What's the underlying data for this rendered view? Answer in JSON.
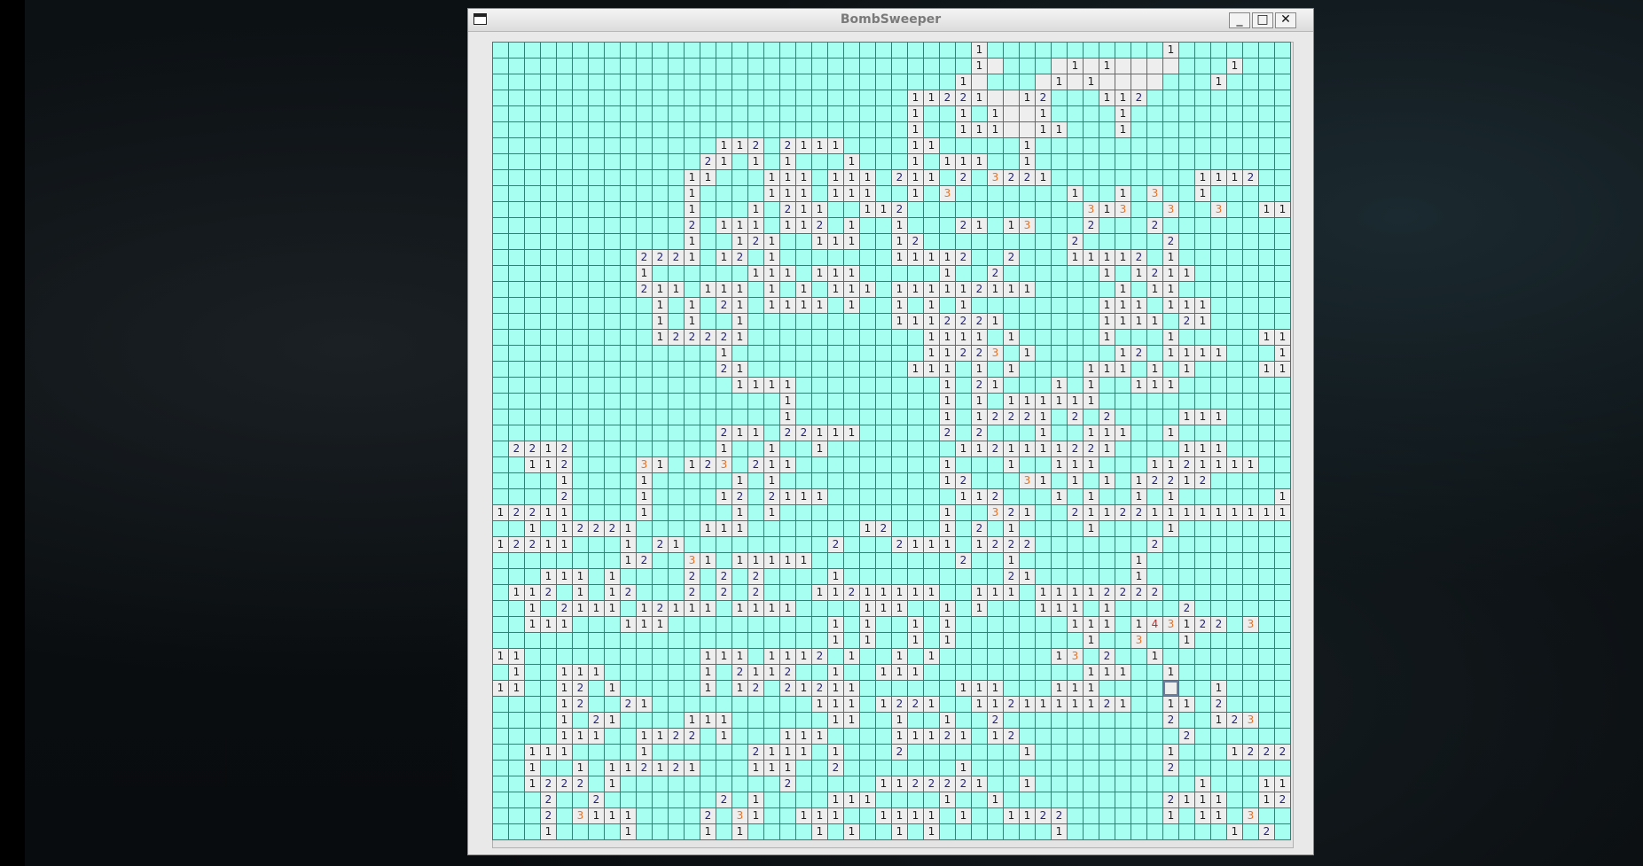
{
  "window": {
    "title": "BombSweeper",
    "buttons": {
      "minimize": "_",
      "maximize": "□",
      "close": "✕"
    }
  },
  "board": {
    "rows": 50,
    "cols": 50,
    "legend": {
      "#": "unrevealed",
      ".": "revealed-empty",
      "1-8": "revealed-number",
      "*": "selected-unrevealed"
    },
    "grid": [
      "##############################1###########1#######",
      "##############################1.###.1.1....###1###",
      "#############################1.###.1.1....###1###",
      "##########################11221..12###112#########",
      "##########################1##1#1..1####1##########",
      "##########################1##111..11###1##########",
      "##############112#2111####11#####1################",
      "#############21#1#1###1###1#111##1################",
      "############11###111#111#211#2#3221#########1112##",
      "############1####111#111##1#3#######1##1#3##1#####",
      "############1###1#211##112###########313##3##3##11",
      "############2#111#112#1##1###21#13###2###2#######",
      "############1##121##111##12#########2#####2######",
      "#########2221#12#1#######11112##2###11112#1######",
      "#########1######111#111#####1##2######1#1211#####",
      "#########211#111#1#1#111#111112111#####1#11######",
      "##########1#1#21#1111#1##1#1#1########111#111#####",
      "##########1#1##1#########1112221######1111#21#####",
      "##########122221###########1111#1#####1###1#####11",
      "##############1############11223#1#####12#1111###1",
      "##############21##########111#1#1####111#1#1####11",
      "###############1111#########1#21###1#1##111#######",
      "##################1#########1#1#111111############",
      "##################1#########1#12221#2#2####111####",
      "##############211#22111#####2#2###1##111##1#######",
      "#2212#########1##1##1########1121111221####111####",
      "##112####31#123#211#########1###1##111###1121111##",
      "####1####1#####1#1##########12###31#1#1#12212#####",
      "####2####1####12#2111########112###1#1##1#1######1",
      "12211####1#####1#1##########1##321##21122111111111",
      "##1#12221####111#######12###1#2#1####1####1#######",
      "12211###1#21#########2###2111#1222#######2########",
      "########12##31#11111#########2##1#######1########",
      "###111#1####2#2#2####1##########21######1########",
      "#112#1#12###2#2#2###11211111##111#11112222#######",
      "##1#2111#12111#1111####111##1#1###111#1####2######",
      "##111###111##########1#1##1#1#######111#143122#3#",
      "#####################1#1##1#1########1##3##1#####",
      "11###########111#1112#1##1#1#######13#2##1#######",
      "#1##111######1#2112##1##111##########111##1######",
      "11##12#1#####1#12#21211######111###111####*##1###",
      "####12##21##########111#1221##1121111121##11#2###",
      "####1#21####111######11##1##1##2##########2##123#",
      "####111##1122#1###111####11121#12##########2######",
      "##111####1######2111#1###2#######1########1###12222",
      "##1##1#112121###111##2#######1############2#######111",
      "##1222#1##########2#####1122221##1##########1###111#",
      "###2##2#######2#1####111####1##1##########2111##12221",
      "###2#3111####2#31##111##1111#1##1122######1#11#3#",
      "###1####1####1#1####1#1##1#1#######1##########1#2##"
    ]
  }
}
